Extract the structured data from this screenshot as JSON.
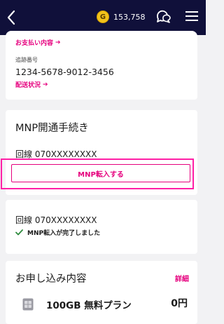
{
  "header": {
    "coin_letter": "G",
    "points": "153,758"
  },
  "payment": {
    "payment_link": "お支払い内容",
    "tracking_label": "追跡番号",
    "tracking_number": "1234-5678-9012-3456",
    "delivery_link": "配送状況"
  },
  "mnp": {
    "title": "MNP開通手続き",
    "line_label": "回線 070XXXXXXXX",
    "button_label": "MNP転入する"
  },
  "mnp_done": {
    "line_label": "回線 070XXXXXXXX",
    "status": "MNP転入が完了しました"
  },
  "order": {
    "title": "お申し込み内容",
    "detail_link": "詳細",
    "plan_name": "100GB 無料プラン",
    "plan_price": "0円"
  },
  "colors": {
    "accent": "#e6007e",
    "header_bg": "#10103a",
    "highlight": "#ff1fa6"
  },
  "icons": [
    "back-chevron-icon",
    "coin-icon",
    "chat-icon",
    "menu-icon",
    "arrow-right-icon",
    "check-icon",
    "sim-card-icon"
  ]
}
